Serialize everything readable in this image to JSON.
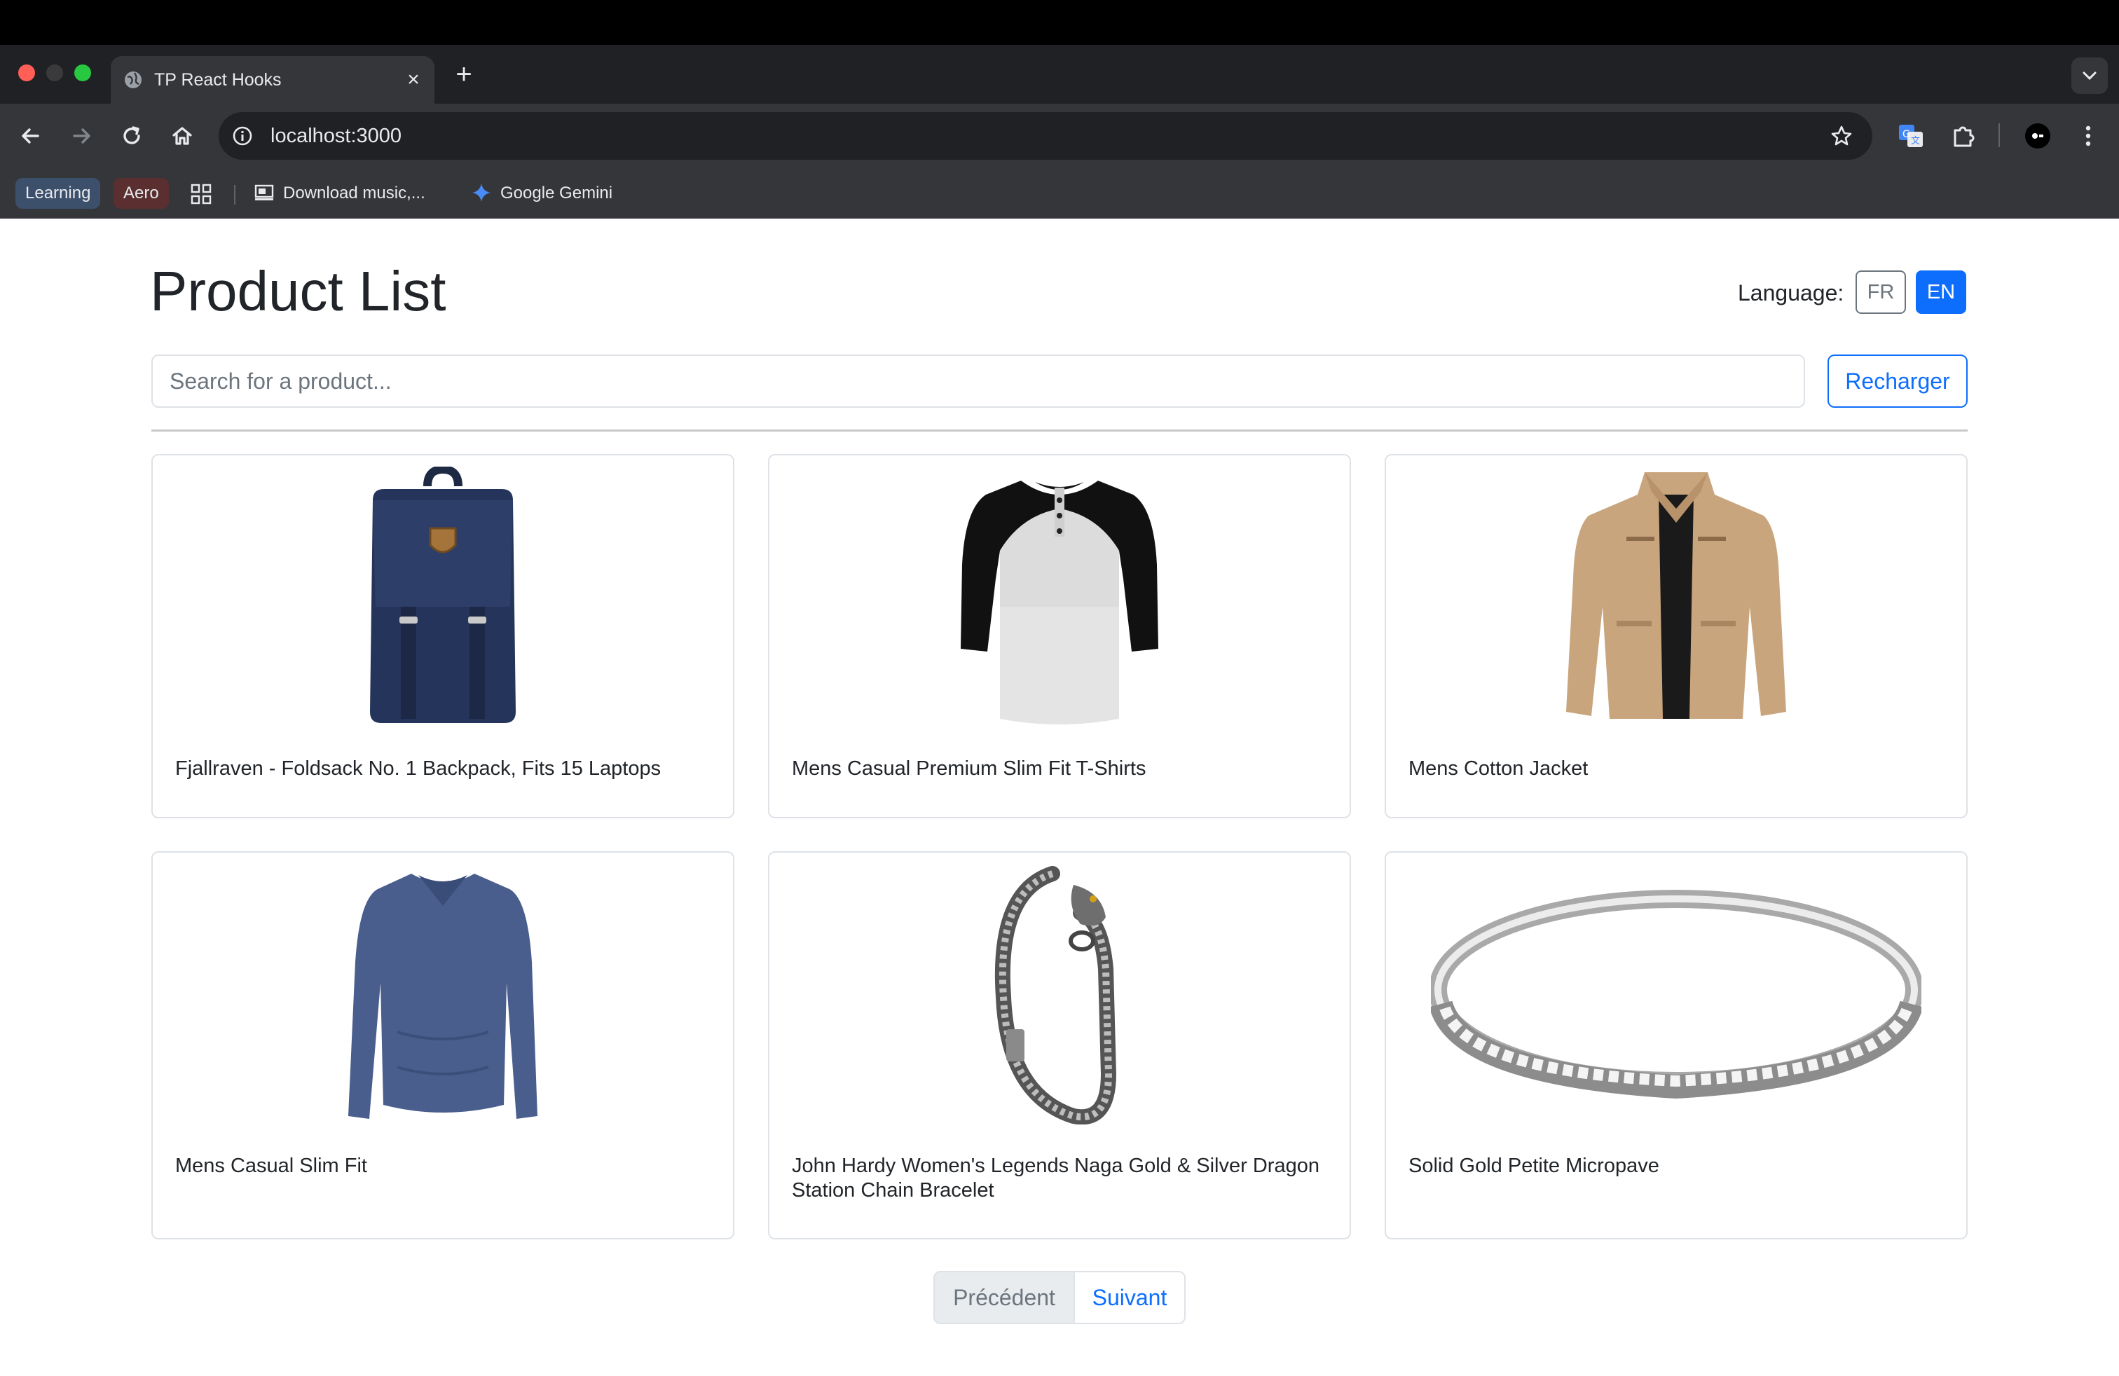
{
  "browser": {
    "tab_title": "TP React Hooks",
    "tab_close": "×",
    "new_tab": "+",
    "url": "localhost:3000",
    "bookmarks": {
      "learning": "Learning",
      "aero": "Aero",
      "download": "Download music,...",
      "gemini": "Google Gemini"
    }
  },
  "page": {
    "title": "Product List",
    "language_label": "Language:",
    "lang_fr": "FR",
    "lang_en": "EN",
    "search_placeholder": "Search for a product...",
    "reload_label": "Recharger",
    "products": [
      {
        "title": "Fjallraven - Foldsack No. 1 Backpack, Fits 15 Laptops",
        "image": "backpack"
      },
      {
        "title": "Mens Casual Premium Slim Fit T-Shirts",
        "image": "raglan-tshirt"
      },
      {
        "title": "Mens Cotton Jacket",
        "image": "cotton-jacket"
      },
      {
        "title": "Mens Casual Slim Fit",
        "image": "long-sleeve-shirt"
      },
      {
        "title": "John Hardy Women's Legends Naga Gold & Silver Dragon Station Chain Bracelet",
        "image": "chain-bracelet"
      },
      {
        "title": "Solid Gold Petite Micropave",
        "image": "diamond-ring"
      }
    ],
    "pagination": {
      "prev": "Précédent",
      "next": "Suivant"
    }
  },
  "colors": {
    "primary": "#0d6efd",
    "secondary": "#6c757d",
    "chrome_dark": "#202124",
    "chrome_toolbar": "#35363a"
  }
}
